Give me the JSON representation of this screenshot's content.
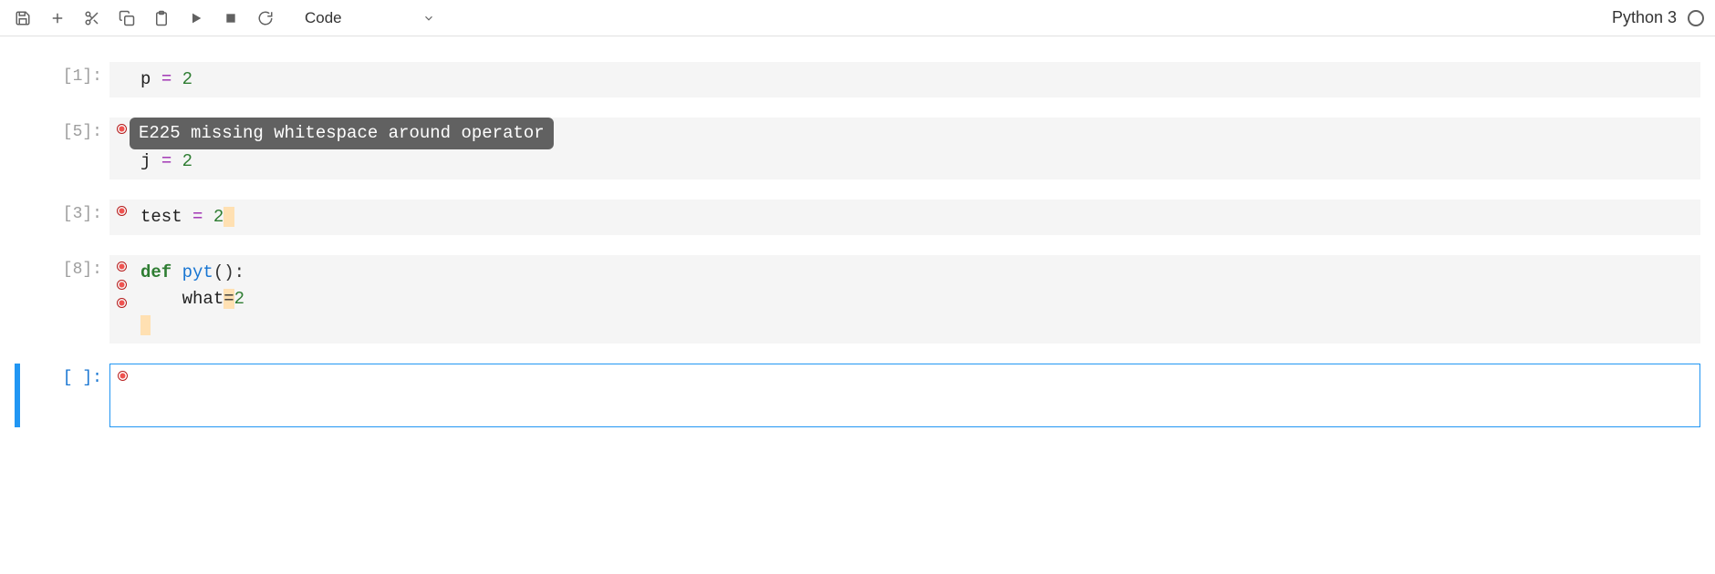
{
  "toolbar": {
    "cell_type": "Code"
  },
  "kernel": {
    "name": "Python 3"
  },
  "cells": [
    {
      "prompt_open": "[",
      "prompt_num": "1",
      "prompt_close": "]:",
      "lines": [
        {
          "tokens": [
            {
              "t": "p",
              "cls": "tok-name"
            },
            {
              "t": " ",
              "cls": ""
            },
            {
              "t": "=",
              "cls": "tok-op"
            },
            {
              "t": " ",
              "cls": ""
            },
            {
              "t": "2",
              "cls": "tok-num"
            }
          ]
        }
      ]
    },
    {
      "prompt_open": "[",
      "prompt_num": "5",
      "prompt_close": "]:",
      "lint_markers": 1,
      "tooltip": "E225 missing whitespace around operator",
      "tooltip_top": 0,
      "lines": [
        {
          "tokens": [
            {
              "t": " ",
              "cls": "code-reserve"
            }
          ]
        },
        {
          "tokens": [
            {
              "t": "j",
              "cls": "tok-name"
            },
            {
              "t": " ",
              "cls": ""
            },
            {
              "t": "=",
              "cls": "tok-op"
            },
            {
              "t": " ",
              "cls": ""
            },
            {
              "t": "2",
              "cls": "tok-num"
            }
          ]
        }
      ]
    },
    {
      "prompt_open": "[",
      "prompt_num": "3",
      "prompt_close": "]:",
      "lint_markers": 1,
      "lines": [
        {
          "tokens": [
            {
              "t": "test",
              "cls": "tok-name"
            },
            {
              "t": " ",
              "cls": ""
            },
            {
              "t": "=",
              "cls": "tok-op"
            },
            {
              "t": " ",
              "cls": ""
            },
            {
              "t": "2",
              "cls": "tok-num"
            },
            {
              "t": " ",
              "cls": "lint-hl"
            }
          ]
        }
      ]
    },
    {
      "prompt_open": "[",
      "prompt_num": "8",
      "prompt_close": "]:",
      "lint_markers": 3,
      "lines": [
        {
          "tokens": [
            {
              "t": "def",
              "cls": "tok-kw"
            },
            {
              "t": " ",
              "cls": ""
            },
            {
              "t": "pyt",
              "cls": "tok-fn"
            },
            {
              "t": "():",
              "cls": ""
            }
          ]
        },
        {
          "tokens": [
            {
              "t": "    ",
              "cls": ""
            },
            {
              "t": "what",
              "cls": "tok-name"
            },
            {
              "t": "=",
              "cls": "lint-hl"
            },
            {
              "t": "2",
              "cls": "tok-num"
            }
          ]
        },
        {
          "tokens": [
            {
              "t": " ",
              "cls": "lint-hl"
            }
          ]
        }
      ]
    },
    {
      "prompt_open": "[",
      "prompt_num": " ",
      "prompt_close": "]:",
      "active": true,
      "lint_markers": 1,
      "lines": [
        {
          "tokens": [
            {
              "t": " ",
              "cls": "code-reserve"
            }
          ]
        },
        {
          "tokens": [
            {
              "t": " ",
              "cls": "code-reserve"
            }
          ]
        }
      ]
    }
  ]
}
